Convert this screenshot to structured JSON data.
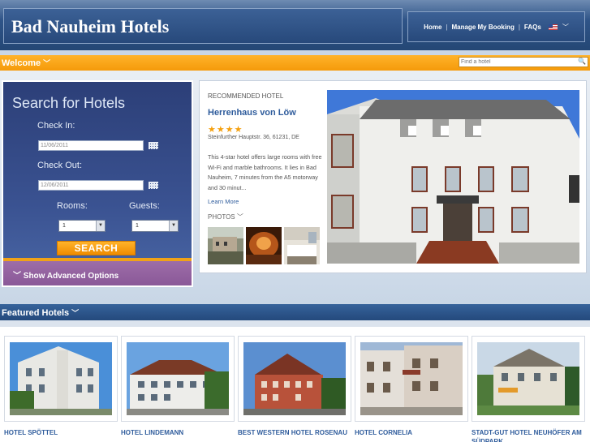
{
  "header": {
    "site_title": "Bad Nauheim Hotels",
    "nav": [
      {
        "label": "Home"
      },
      {
        "label": "Manage My Booking"
      },
      {
        "label": "FAQs"
      }
    ],
    "separator": "|"
  },
  "welcome_bar": {
    "label": "Welcome",
    "search_placeholder": "Find a hotel"
  },
  "search": {
    "title": "Search for Hotels",
    "check_in_label": "Check In:",
    "check_in_value": "11/06/2011",
    "check_out_label": "Check Out:",
    "check_out_value": "12/06/2011",
    "rooms_label": "Rooms:",
    "rooms_value": "1",
    "guests_label": "Guests:",
    "guests_value": "1",
    "button_label": "SEARCH",
    "advanced_label": "Show Advanced Options"
  },
  "recommended": {
    "kicker": "RECOMMENDED HOTEL",
    "name": "Herrenhaus von Löw",
    "stars": "★★★★",
    "rating": 4,
    "address": "Steinfurther Hauptstr. 36, 61231, DE",
    "description": "This 4-star hotel offers large rooms with free Wi-Fi and marble bathrooms. It lies in Bad Nauheim, 7 minutes from the A5 motorway and 30 minut...",
    "more_label": "Learn More",
    "photos_label": "PHOTOS"
  },
  "featured": {
    "label": "Featured Hotels",
    "hotels": [
      {
        "name": "HOTEL SPÖTTEL"
      },
      {
        "name": "HOTEL LINDEMANN"
      },
      {
        "name": "BEST WESTERN HOTEL ROSENAU"
      },
      {
        "name": "HOTEL CORNELIA"
      },
      {
        "name": "STADT-GUT HOTEL NEUHÖFER AM SÜDPARK"
      }
    ]
  },
  "icons": {
    "chevron": "chevron-down-icon",
    "calendar": "calendar-icon",
    "search": "magnifier-icon",
    "flag": "us-flag-icon"
  },
  "colors": {
    "header_blue": "#2f5488",
    "accent_orange": "#f59a0a",
    "link_blue": "#2f5c9c",
    "advanced_purple": "#8a5898",
    "star": "#f5a00e"
  }
}
